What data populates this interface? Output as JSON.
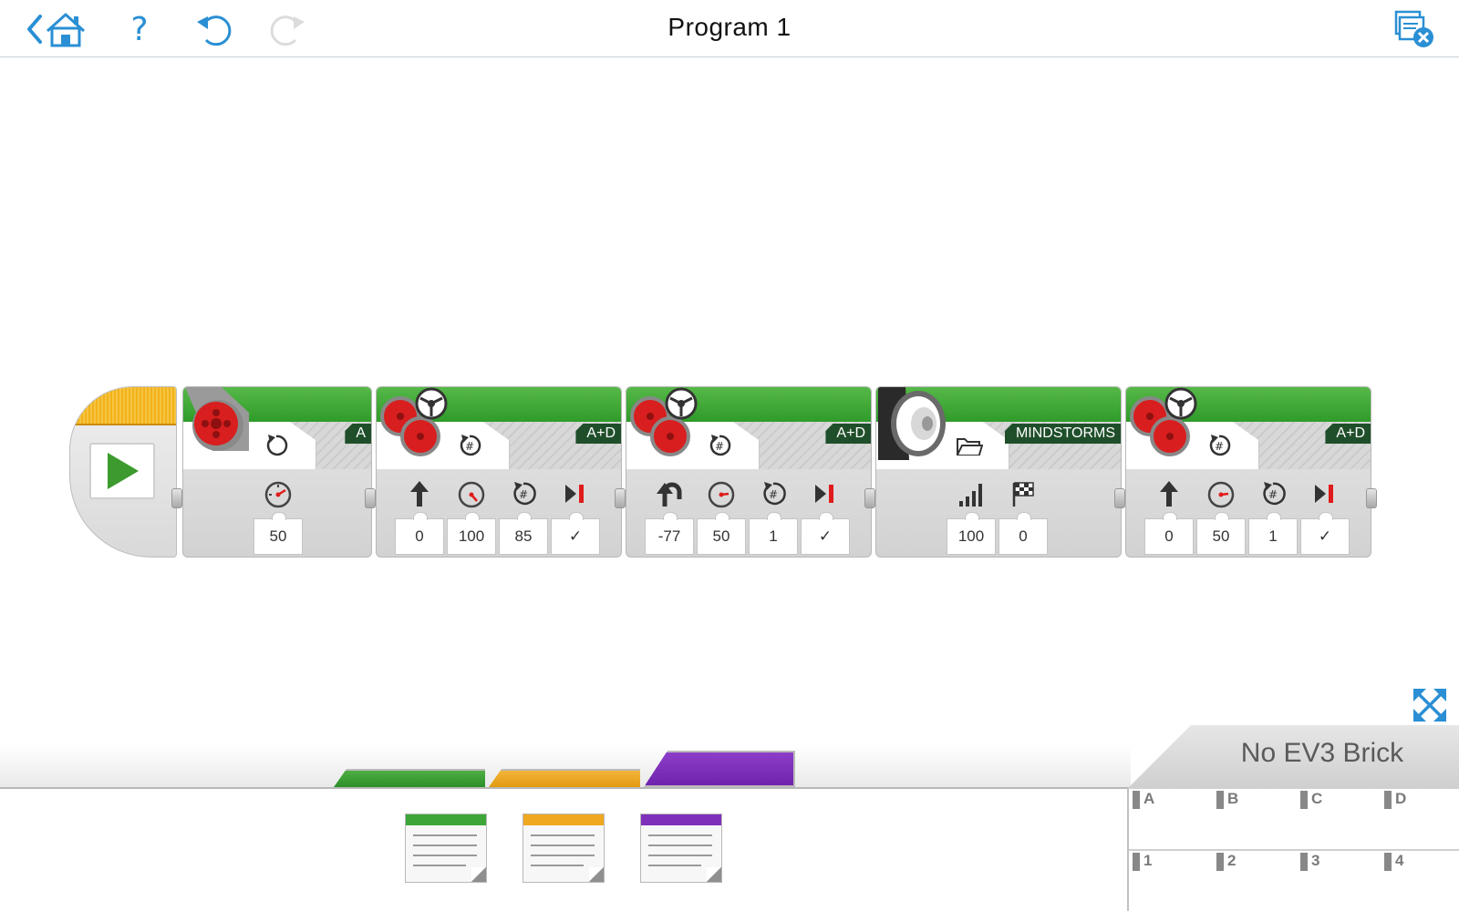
{
  "header": {
    "title": "Program 1",
    "help_glyph": "?",
    "icons": [
      "back-arrow-icon",
      "home-icon",
      "help-icon",
      "undo-icon",
      "redo-icon",
      "close-project-icon"
    ]
  },
  "colors": {
    "accent_blue": "#2a8fd4",
    "block_green": "#3aa634",
    "start_orange": "#f3b21b",
    "palette_green": "#3ea638",
    "palette_orange": "#f0a820",
    "palette_purple": "#7e30bb",
    "stop_red": "#e01b1b"
  },
  "program": {
    "start_block": {
      "icon": "play-icon"
    },
    "blocks": [
      {
        "type": "medium-motor",
        "port": "A",
        "mode_icon": "rotate-icon",
        "params": [
          {
            "icon": "speedometer-icon",
            "value": "50"
          }
        ]
      },
      {
        "type": "move-steering",
        "port": "A+D",
        "mode_icon": "rotations-icon",
        "params": [
          {
            "icon": "steering-straight-icon",
            "value": "0"
          },
          {
            "icon": "speedometer-icon",
            "value": "100"
          },
          {
            "icon": "rotations-count-icon",
            "value": "85"
          },
          {
            "icon": "brake-icon",
            "value": "✓"
          }
        ]
      },
      {
        "type": "move-steering",
        "port": "A+D",
        "mode_icon": "rotations-icon",
        "params": [
          {
            "icon": "steering-turn-icon",
            "value": "-77"
          },
          {
            "icon": "speedometer-icon",
            "value": "50"
          },
          {
            "icon": "rotations-count-icon",
            "value": "1"
          },
          {
            "icon": "brake-icon",
            "value": "✓"
          }
        ]
      },
      {
        "type": "sound",
        "port": "MINDSTORMS",
        "mode_icon": "folder-icon",
        "params": [
          {
            "icon": "volume-icon",
            "value": "100"
          },
          {
            "icon": "play-type-flag-icon",
            "value": "0"
          }
        ]
      },
      {
        "type": "move-steering",
        "port": "A+D",
        "mode_icon": "rotations-icon",
        "params": [
          {
            "icon": "steering-straight-icon",
            "value": "0"
          },
          {
            "icon": "speedometer-icon",
            "value": "50"
          },
          {
            "icon": "rotations-count-icon",
            "value": "1"
          },
          {
            "icon": "brake-icon",
            "value": "✓"
          }
        ]
      }
    ]
  },
  "palette": {
    "tabs": [
      "action-tab",
      "flow-tab",
      "data-tab"
    ],
    "selected_tab": "data-tab",
    "items": [
      "variable-block-green",
      "variable-block-orange",
      "variable-block-purple"
    ]
  },
  "brick": {
    "status": "No EV3 Brick",
    "motor_ports": [
      "A",
      "B",
      "C",
      "D"
    ],
    "sensor_ports": [
      "1",
      "2",
      "3",
      "4"
    ]
  }
}
